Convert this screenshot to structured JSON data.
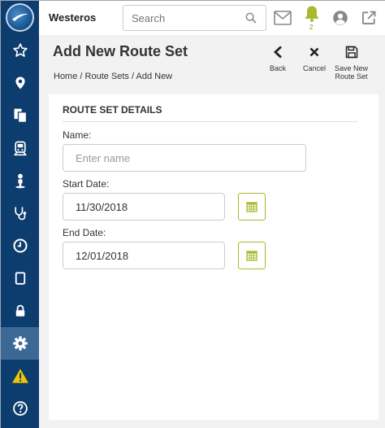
{
  "app": {
    "brand": "Westeros"
  },
  "search": {
    "placeholder": "Search"
  },
  "notifications": {
    "count": "2"
  },
  "page": {
    "title": "Add New Route Set"
  },
  "breadcrumb": {
    "text": "Home / Route Sets / Add New"
  },
  "toolbar": {
    "back_label": "Back",
    "cancel_label": "Cancel",
    "save_label_line1": "Save New",
    "save_label_line2": "Route Set"
  },
  "form": {
    "section_title": "ROUTE SET DETAILS",
    "name_label": "Name:",
    "name_placeholder": "Enter name",
    "start_label": "Start Date:",
    "start_value": "11/30/2018",
    "end_label": "End Date:",
    "end_value": "12/01/2018"
  },
  "sidebar": {
    "items": [
      {
        "icon": "star-icon"
      },
      {
        "icon": "map-marker-icon"
      },
      {
        "icon": "documents-icon"
      },
      {
        "icon": "train-icon"
      },
      {
        "icon": "person-icon"
      },
      {
        "icon": "stethoscope-icon"
      },
      {
        "icon": "clock-icon"
      },
      {
        "icon": "tablet-icon"
      },
      {
        "icon": "lock-icon"
      },
      {
        "icon": "gear-icon",
        "active": true
      },
      {
        "icon": "warning-icon"
      },
      {
        "icon": "help-icon"
      }
    ]
  },
  "colors": {
    "sidebar": "#0d3c6e",
    "sidebar_active": "#3c6896",
    "accent": "#a9b82e",
    "warning": "#f2c500"
  }
}
